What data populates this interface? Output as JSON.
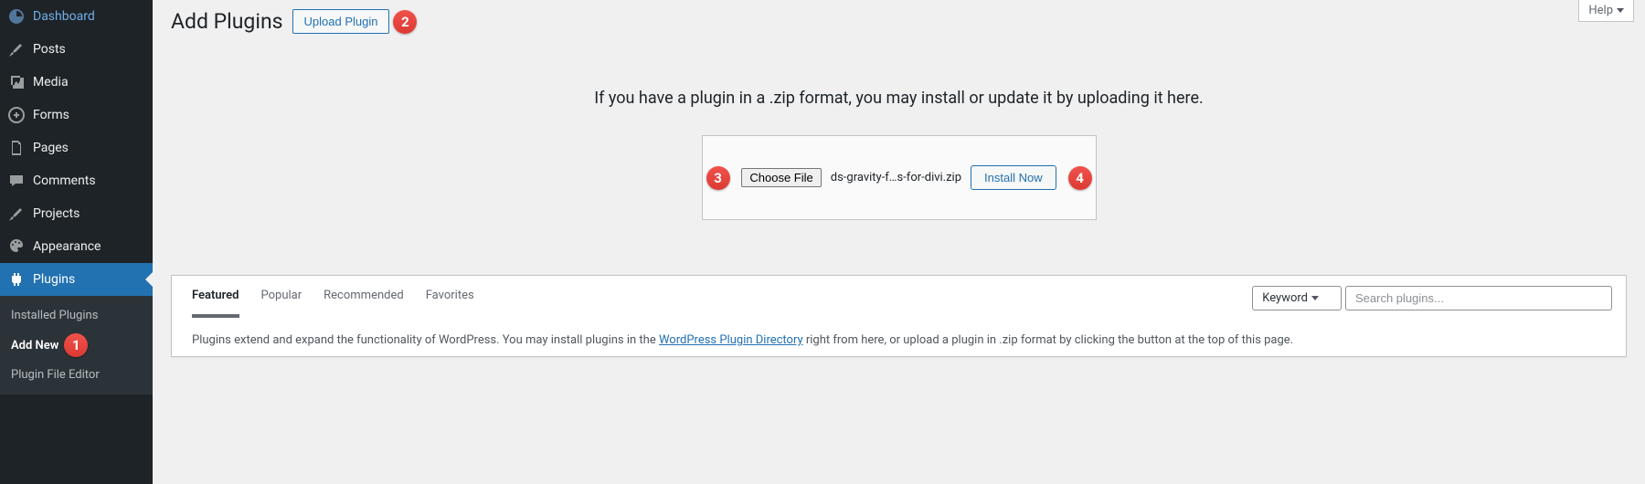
{
  "sidebar": {
    "items": [
      {
        "label": "Dashboard",
        "icon": "dashboard-icon"
      },
      {
        "label": "Posts",
        "icon": "pin-icon"
      },
      {
        "label": "Media",
        "icon": "media-icon"
      },
      {
        "label": "Forms",
        "icon": "forms-icon"
      },
      {
        "label": "Pages",
        "icon": "pages-icon"
      },
      {
        "label": "Comments",
        "icon": "comments-icon"
      },
      {
        "label": "Projects",
        "icon": "pin-icon"
      },
      {
        "label": "Appearance",
        "icon": "appearance-icon"
      },
      {
        "label": "Plugins",
        "icon": "plugin-icon",
        "current": true
      }
    ],
    "submenu": [
      {
        "label": "Installed Plugins"
      },
      {
        "label": "Add New",
        "current": true,
        "badge": "1"
      },
      {
        "label": "Plugin File Editor"
      }
    ]
  },
  "header": {
    "title": "Add Plugins",
    "upload_button": "Upload Plugin",
    "upload_badge": "2",
    "help_button": "Help"
  },
  "upload": {
    "instructions": "If you have a plugin in a .zip format, you may install or update it by uploading it here.",
    "choose_button": "Choose File",
    "choose_badge": "3",
    "filename": "ds-gravity-f…s-for-divi.zip",
    "install_button": "Install Now",
    "install_badge": "4"
  },
  "filter": {
    "tabs": [
      {
        "label": "Featured",
        "active": true
      },
      {
        "label": "Popular"
      },
      {
        "label": "Recommended"
      },
      {
        "label": "Favorites"
      }
    ],
    "select_label": "Keyword",
    "search_placeholder": "Search plugins...",
    "description_before": "Plugins extend and expand the functionality of WordPress. You may install plugins in the ",
    "description_link": "WordPress Plugin Directory",
    "description_after": " right from here, or upload a plugin in .zip format by clicking the button at the top of this page."
  }
}
